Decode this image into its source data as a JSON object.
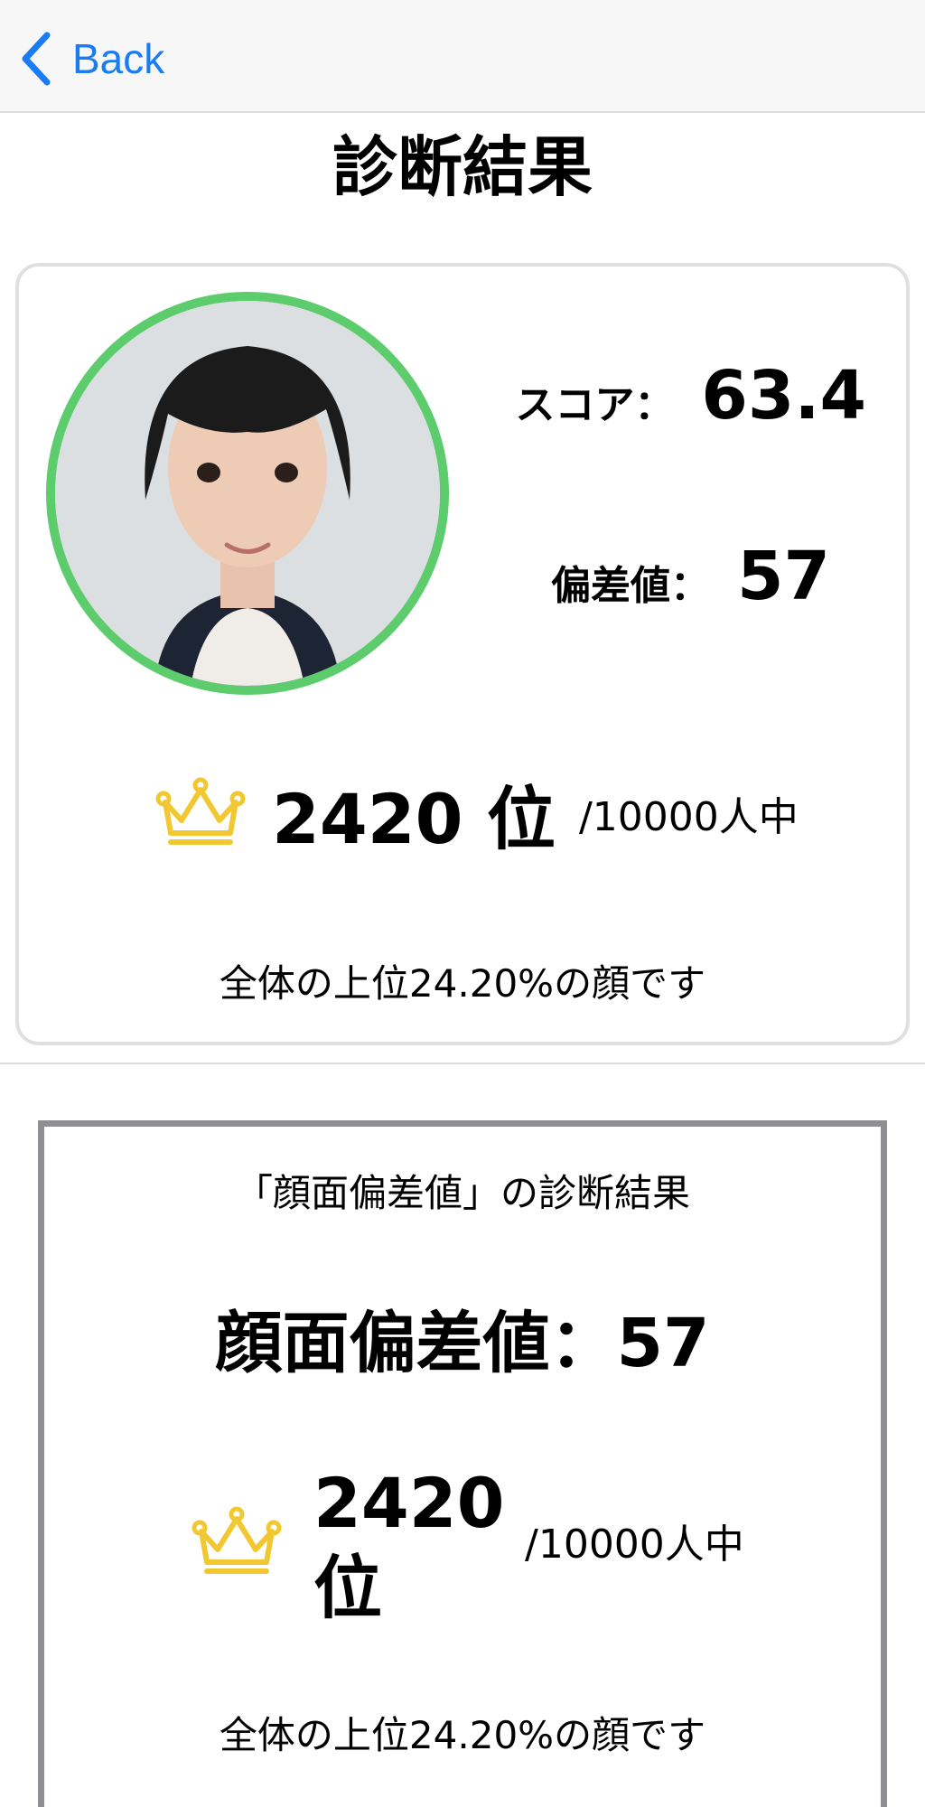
{
  "navbar": {
    "back_label": "Back"
  },
  "page": {
    "title": "診断結果"
  },
  "result": {
    "score_label": "スコア：",
    "score_value": "63.4",
    "deviation_label": "偏差値：",
    "deviation_value": "57",
    "rank": "2420 位",
    "rank_total": "/10000人中",
    "top_text": "全体の上位24.20%の顔です"
  },
  "share_card": {
    "caption": "「顔面偏差値」の診断結果",
    "deviation": "顔面偏差値：57",
    "rank": "2420 位",
    "rank_total": "/10000人中",
    "top_text": "全体の上位24.20%の顔です"
  },
  "colors": {
    "accent_blue": "#1a7cf5",
    "avatar_ring": "#5ccc6c",
    "crown": "#f2c832"
  },
  "icons": {
    "back": "chevron-left-icon",
    "rank": "crown-icon"
  }
}
